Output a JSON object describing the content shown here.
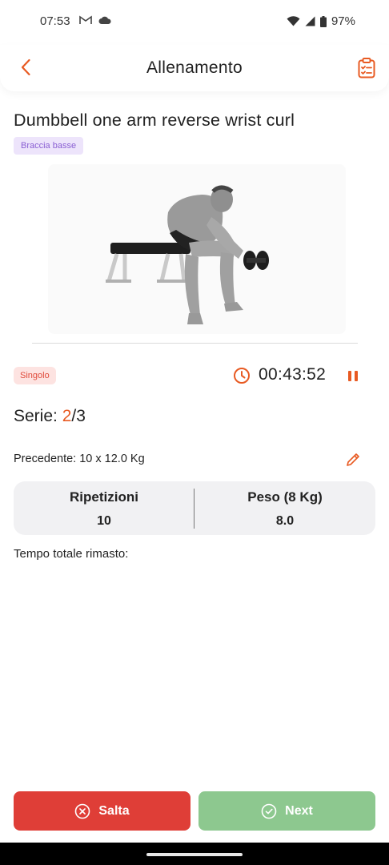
{
  "status_bar": {
    "time": "07:53",
    "battery": "97%",
    "icons": [
      "gmail-icon",
      "cloud-icon",
      "wifi-icon",
      "signal-icon",
      "battery-icon"
    ]
  },
  "app_bar": {
    "title": "Allenamento",
    "back_icon": "chevron-left-icon",
    "action_icon": "clipboard-list-icon"
  },
  "exercise": {
    "name": "Dumbbell one arm reverse wrist curl",
    "muscle_tag": "Braccia basse"
  },
  "session": {
    "mode_tag": "Singolo",
    "timer": "00:43:52",
    "serie_label": "Serie: ",
    "serie_current": "2",
    "serie_total": "/3",
    "previous": "Precedente: 10 x 12.0 Kg"
  },
  "stats": {
    "reps_label": "Ripetizioni",
    "reps_value": "10",
    "weight_label": "Peso (8 Kg)",
    "weight_value": "8.0"
  },
  "rest": {
    "label": "Tempo totale rimasto:"
  },
  "actions": {
    "skip_label": "Salta",
    "next_label": "Next"
  },
  "colors": {
    "accent": "#e85a22",
    "skip_button": "#df3e37",
    "next_button": "#8dc88f",
    "muscle_tag_bg": "#ede4fb",
    "mode_tag_bg": "#fde3e1"
  }
}
